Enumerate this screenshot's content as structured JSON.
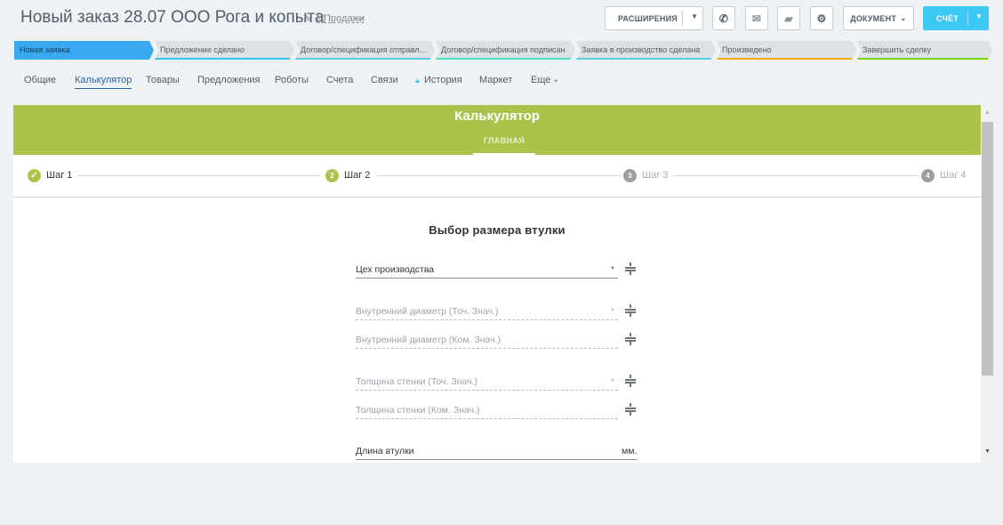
{
  "header": {
    "title": "Новый заказ 28.07 ООО Рога и  копыта",
    "edit_icon": "pencil-icon",
    "category": "Продажи",
    "extensions_label": "РАСШИРЕНИЯ",
    "document_label": "ДОКУМЕНТ",
    "invoice_label": "СЧЁТ",
    "icons": [
      "phone-icon",
      "mail-icon",
      "chat-icon",
      "gear-icon"
    ]
  },
  "stages": [
    {
      "label": "Новая заявка",
      "color": "#39a8ef",
      "active": true
    },
    {
      "label": "Предложение сделано",
      "color": "#2fc6f6"
    },
    {
      "label": "Договор/спецификация отправл...",
      "color": "#55d0e0"
    },
    {
      "label": "Договор/спецификация подписан",
      "color": "#47e4c2"
    },
    {
      "label": "Заявка в производство сделана",
      "color": "#55d0e0"
    },
    {
      "label": "Произведено",
      "color": "#ffa900"
    },
    {
      "label": "Завершить сделку",
      "color": "#7bd500"
    }
  ],
  "tabs": [
    {
      "label": "Общие"
    },
    {
      "label": "Калькулятор",
      "active": true
    },
    {
      "label": "Товары"
    },
    {
      "label": "Предложения"
    },
    {
      "label": "Роботы"
    },
    {
      "label": "Счета"
    },
    {
      "label": "Связи"
    },
    {
      "label": "История",
      "icon": "lock-icon"
    },
    {
      "label": "Маркет"
    },
    {
      "label": "Еще"
    }
  ],
  "calculator": {
    "title": "Калькулятор",
    "subtab": "ГЛАВНАЯ",
    "accent_color": "#aac34b",
    "steps": [
      {
        "marker": "✓",
        "label": "Шаг 1",
        "state": "done"
      },
      {
        "marker": "2",
        "label": "Шаг 2",
        "state": "current"
      },
      {
        "marker": "3",
        "label": "Шаг 3",
        "state": "pending"
      },
      {
        "marker": "4",
        "label": "Шаг 4",
        "state": "pending"
      }
    ],
    "form_title": "Выбор размера втулки",
    "fields": [
      {
        "label": "Цех производства",
        "type": "select",
        "enabled": true
      },
      {
        "label": "Внутренний диаметр (Точ. Знач.)",
        "type": "select",
        "enabled": false
      },
      {
        "label": "Внутренний диаметр (Ком. Знач.)",
        "type": "text",
        "enabled": false
      },
      {
        "label": "Толщина стенки (Точ. Знач.)",
        "type": "select",
        "enabled": false
      },
      {
        "label": "Толщина стенки (Ком. Знач.)",
        "type": "text",
        "enabled": false
      },
      {
        "label": "Длина втулки",
        "type": "text",
        "enabled": true,
        "unit": "мм."
      }
    ]
  }
}
